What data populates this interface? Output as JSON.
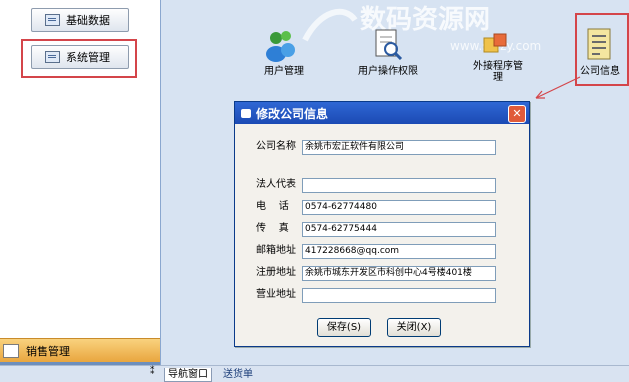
{
  "nav": {
    "basic_data": "基础数据",
    "system_management": "系统管理",
    "sales_management": "销售管理"
  },
  "tabs": {
    "nav_window": "导航窗口",
    "delivery_note": "送货单"
  },
  "main": {
    "icons": {
      "user_management": "用户管理",
      "user_permissions": "用户操作权限",
      "external_program_line1": "外接程序管",
      "external_program_line2": "理",
      "company_info": "公司信息"
    },
    "watermark": "数码资源网",
    "watermark_url": "www.smzy.com"
  },
  "dialog": {
    "title": "修改公司信息",
    "fields": {
      "company_name": {
        "label": "公司名称",
        "value": "余姚市宏正软件有限公司"
      },
      "legal_rep": {
        "label": "法人代表",
        "value": ""
      },
      "phone": {
        "label": "电    话",
        "value": "0574-62774480"
      },
      "fax": {
        "label": "传    真",
        "value": "0574-62775444"
      },
      "email": {
        "label": "邮箱地址",
        "value": "417228668@qq.com"
      },
      "reg_address": {
        "label": "注册地址",
        "value": "余姚市城东开发区市科创中心4号楼401楼"
      },
      "biz_address": {
        "label": "营业地址",
        "value": ""
      }
    },
    "save_label": "保存(S)",
    "close_label": "关闭(X)"
  },
  "colors": {
    "annotation": "#d4454a",
    "title_bar": "#2f67d4",
    "main_bg": "#d7e3f2"
  }
}
